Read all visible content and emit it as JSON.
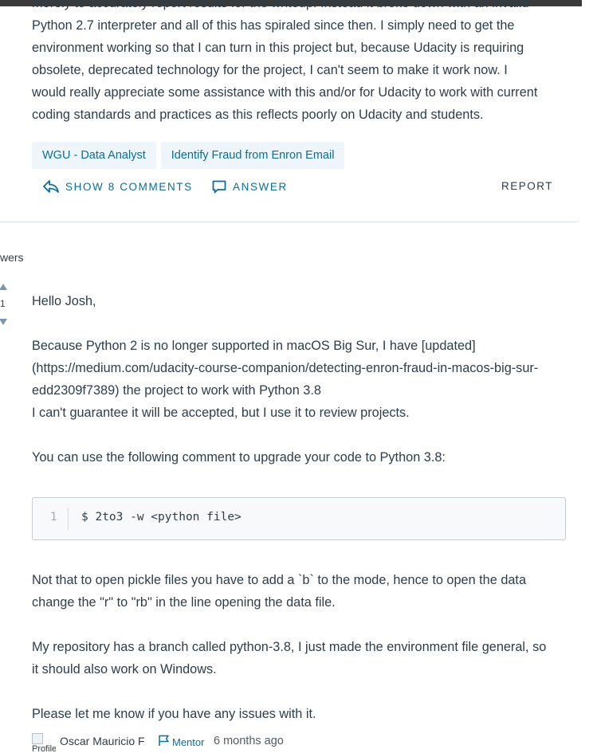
{
  "question": {
    "clipped_line": "merely to accurately report results for the writeup. Instead it broke down with an invalid",
    "lines": [
      "Python 2.7 interpreter and all of this has spiraled since then. I simply need to get the",
      "environment working so that I can turn in this project but, because Udacity is requiring",
      "obsolete, deprecated technology for the project, I can't seem to make it work now. I",
      "would really appreciate some assistance with this and/or for Udacity to work with current",
      "coding standards and practices as this reflects poorly on Udacity and students."
    ]
  },
  "tags": [
    "WGU - Data Analyst",
    "Identify Fraud from Enron Email"
  ],
  "actions": {
    "show_comments": "SHOW 8 COMMENTS",
    "answer": "ANSWER",
    "report": "REPORT"
  },
  "answers_section": {
    "label": "wers"
  },
  "answer": {
    "vote_count": "1",
    "greeting": "Hello Josh,",
    "paragraph1": [
      "Because Python 2 is no longer supported in macOS Big Sur, I have [updated]",
      "(https://medium.com/udacity-course-companion/detecting-enron-fraud-in-macos-big-sur-",
      "edd2309f7389) the project to work with Python 3.8",
      "I can't guarantee it will be accepted, but I use it to review projects."
    ],
    "paragraph2": "You can use the following comment to upgrade your code to Python 3.8:",
    "code": {
      "line_number": "1",
      "text": "$ 2to3 -w <python file>"
    },
    "paragraph3": [
      "Not that to open pickle files you have to add a `b` to the mode, hence to open the data",
      "change the \"r\" to \"rb\" in the line opening the data file."
    ],
    "paragraph4": [
      "My repository has a branch called python-3.8, I just made the environment file general, so",
      "it should also work on Windows."
    ],
    "paragraph5": "Please let me know if you have any issues with it.",
    "author": {
      "avatar_alt": "Profile",
      "name": "Oscar Mauricio F",
      "badge": "Mentor",
      "timestamp": "6 months ago"
    }
  },
  "colors": {
    "link": "#0b6e99",
    "tag_bg": "#eef6fb",
    "text": "#2e3d49",
    "code_bg": "#f7f9fa"
  }
}
